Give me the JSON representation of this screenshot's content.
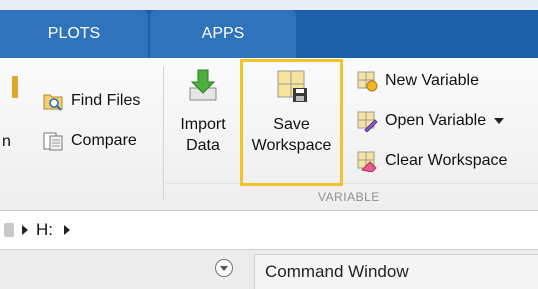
{
  "tabs": [
    {
      "label": "PLOTS"
    },
    {
      "label": "APPS"
    }
  ],
  "ribbon": {
    "file_group": {
      "find_files": "Find Files",
      "compare": "Compare",
      "partial_label": "n"
    },
    "variable_group": {
      "import_data_line1": "Import",
      "import_data_line2": "Data",
      "save_workspace_line1": "Save",
      "save_workspace_line2": "Workspace",
      "new_variable": "New Variable",
      "open_variable": "Open Variable",
      "clear_workspace": "Clear Workspace",
      "group_label": "VARIABLE"
    }
  },
  "path_bar": {
    "drive": "H:"
  },
  "panels": {
    "command_window_title": "Command Window"
  },
  "colors": {
    "tab_strip": "#1d5fa8",
    "tab": "#2f73bc",
    "highlight": "#f3c32e"
  }
}
